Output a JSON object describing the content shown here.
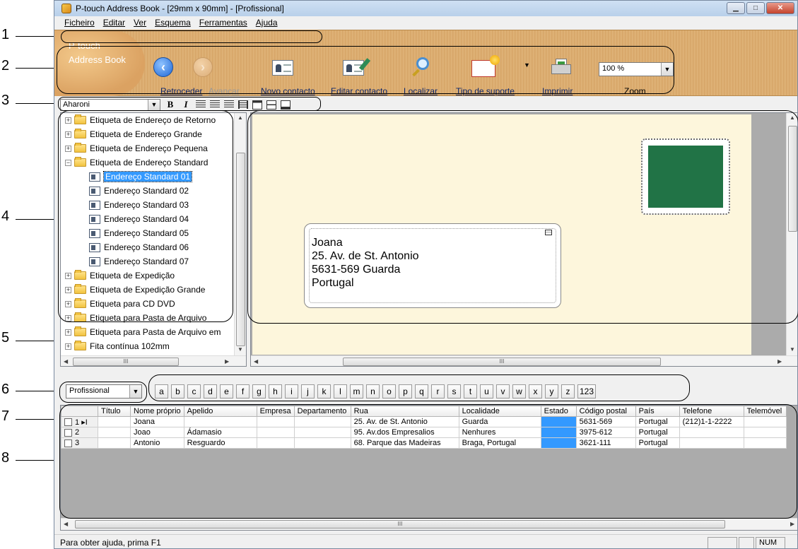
{
  "window": {
    "title": "P-touch Address Book - [29mm x 90mm] - [Profissional]"
  },
  "callouts": [
    "1",
    "2",
    "3",
    "4",
    "5",
    "6",
    "7",
    "8"
  ],
  "menu": [
    "Ficheiro",
    "Editar",
    "Ver",
    "Esquema",
    "Ferramentas",
    "Ajuda"
  ],
  "toolbar": {
    "brand_line1": "P-touch",
    "brand_line2": "Address Book",
    "back": "Retroceder",
    "forward": "Avançar",
    "new_contact": "Novo contacto",
    "edit_contact": "Editar contacto",
    "find": "Localizar",
    "media_type": "Tipo de suporte",
    "print": "Imprimir",
    "zoom_value": "100 %",
    "zoom_label": "Zoom"
  },
  "formatbar": {
    "font": "Aharoni",
    "bold": "B",
    "italic": "I"
  },
  "tree": [
    {
      "label": "Etiqueta de Endereço de Retorno",
      "type": "folder",
      "expander": "+"
    },
    {
      "label": "Etiqueta de Endereço Grande",
      "type": "folder",
      "expander": "+"
    },
    {
      "label": "Etiqueta de Endereço Pequena",
      "type": "folder",
      "expander": "+"
    },
    {
      "label": "Etiqueta de Endereço Standard",
      "type": "folder",
      "expander": "−"
    },
    {
      "label": "Endereço Standard 01",
      "type": "leaf",
      "selected": true
    },
    {
      "label": "Endereço Standard 02",
      "type": "leaf"
    },
    {
      "label": "Endereço Standard 03",
      "type": "leaf"
    },
    {
      "label": "Endereço Standard 04",
      "type": "leaf"
    },
    {
      "label": "Endereço Standard 05",
      "type": "leaf"
    },
    {
      "label": "Endereço Standard 06",
      "type": "leaf"
    },
    {
      "label": "Endereço Standard 07",
      "type": "leaf"
    },
    {
      "label": "Etiqueta de Expedição",
      "type": "folder",
      "expander": "+"
    },
    {
      "label": "Etiqueta de Expedição Grande",
      "type": "folder",
      "expander": "+"
    },
    {
      "label": "Etiqueta para CD DVD",
      "type": "folder",
      "expander": "+"
    },
    {
      "label": "Etiqueta para Pasta de Arquivo",
      "type": "folder",
      "expander": "+"
    },
    {
      "label": "Etiqueta para Pasta de Arquivo em",
      "type": "folder",
      "expander": "+"
    },
    {
      "label": "Fita contínua 102mm",
      "type": "folder",
      "expander": "+"
    }
  ],
  "preview": {
    "address": [
      "Joana",
      "25. Av. de St. Antonio",
      "5631-569 Guarda",
      "Portugal"
    ]
  },
  "indexbar": {
    "view": "Profissional",
    "letters": [
      "a",
      "b",
      "c",
      "d",
      "e",
      "f",
      "g",
      "h",
      "i",
      "j",
      "k",
      "l",
      "m",
      "n",
      "o",
      "p",
      "q",
      "r",
      "s",
      "t",
      "u",
      "v",
      "w",
      "x",
      "y",
      "z",
      "123"
    ]
  },
  "grid": {
    "columns": [
      "Título",
      "Nome próprio",
      "Apelido",
      "Empresa",
      "Departamento",
      "Rua",
      "Localidade",
      "Estado",
      "Código postal",
      "País",
      "Telefone",
      "Telemóvel"
    ],
    "rows": [
      {
        "num": "1",
        "marker": "▸I",
        "values": [
          "",
          "Joana",
          "",
          "",
          "",
          "25. Av. de St. Antonio",
          "Guarda",
          "",
          "5631-569",
          "Portugal",
          "(212)1-1-2222",
          ""
        ]
      },
      {
        "num": "2",
        "marker": "",
        "values": [
          "",
          "Joao",
          "Ádamasio",
          "",
          "",
          "95. Av.dos Empresalios",
          "Nenhures",
          "",
          "3975-612",
          "Portugal",
          "",
          ""
        ]
      },
      {
        "num": "3",
        "marker": "",
        "values": [
          "",
          "Antonio",
          "Resguardo",
          "",
          "",
          "68. Parque das Madeiras",
          "Braga, Portugal",
          "",
          "3621-111",
          "Portugal",
          "",
          ""
        ]
      }
    ]
  },
  "status": {
    "help": "Para obter ajuda, prima F1",
    "num": "NUM"
  }
}
